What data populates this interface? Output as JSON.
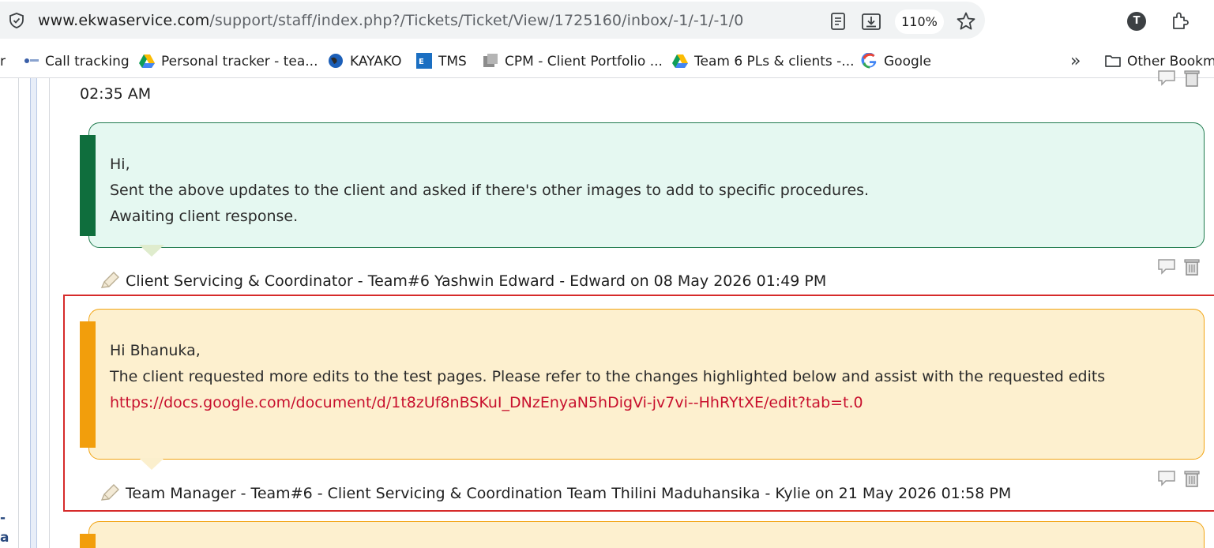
{
  "browser": {
    "url_host": "www.ekwaservice.com",
    "url_path": "/support/staff/index.php?/Tickets/Ticket/View/1725160/inbox/-1/-1/-1/0",
    "zoom": "110%",
    "profile_initial": "T"
  },
  "bookmarks": {
    "items": [
      {
        "label": "r"
      },
      {
        "label": "Call tracking"
      },
      {
        "label": "Personal tracker - tea..."
      },
      {
        "label": "KAYAKO"
      },
      {
        "label": "TMS"
      },
      {
        "label": "CPM - Client Portfolio ..."
      },
      {
        "label": "Team 6 PLs & clients -..."
      },
      {
        "label": "Google"
      }
    ],
    "overflow": "»",
    "other": "Other Bookma"
  },
  "rail": {
    "text_line1": "-",
    "text_line2": "a"
  },
  "thread": {
    "prev_time": "02:35 AM",
    "posts": [
      {
        "lines": [
          "Hi,",
          "Sent the above updates to the client and asked if there's other images to add to specific procedures.",
          "Awaiting client response."
        ],
        "author_line": "Client Servicing & Coordinator - Team#6 Yashwin Edward - Edward on 08 May 2026 01:49 PM",
        "accent": "#0f6e3d"
      },
      {
        "lines": [
          "Hi Bhanuka,",
          "The client requested more edits to the test pages. Please refer to the changes highlighted below and assist with the requested edits"
        ],
        "link": "https://docs.google.com/document/d/1t8zUf8nBSKuI_DNzEnyaN5hDigVi-jv7vi--HhRYtXE/edit?tab=t.0",
        "author_line": "Team Manager - Team#6 - Client Servicing & Coordination Team Thilini Maduhansika - Kylie on 21 May 2026 01:58 PM",
        "accent": "#f29e0c"
      }
    ]
  },
  "icons": {
    "comment": "comment-icon",
    "delete": "trash-icon",
    "pencil": "pencil-icon"
  }
}
